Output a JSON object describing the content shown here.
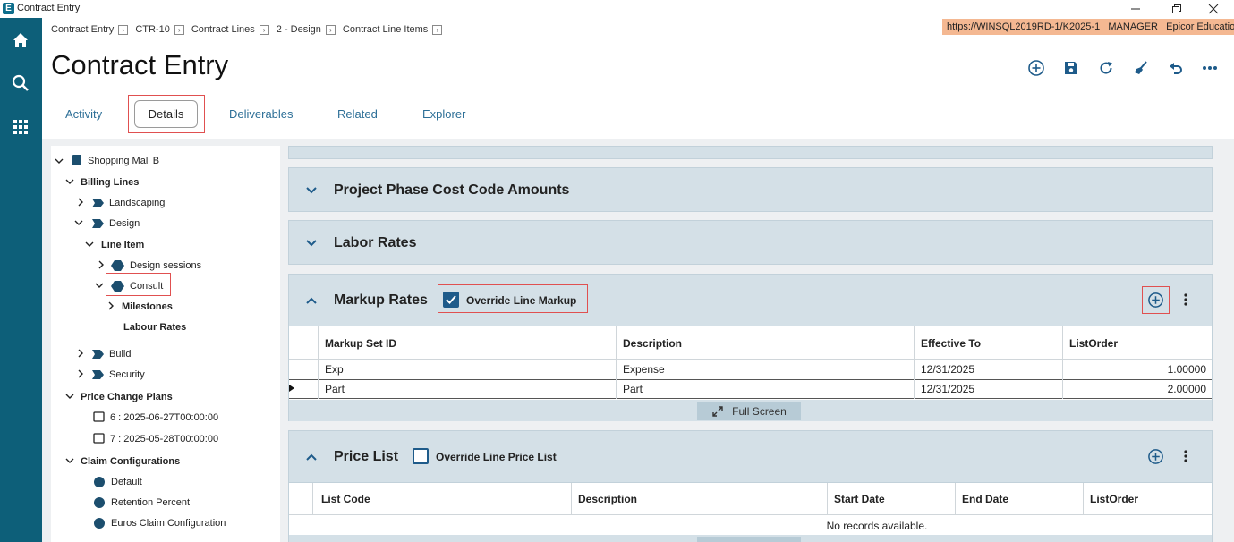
{
  "window": {
    "title": "Contract Entry",
    "logo": "E"
  },
  "breadcrumbs": [
    "Contract Entry",
    "CTR-10",
    "Contract Lines",
    "2 - Design",
    "Contract Line Items"
  ],
  "env": {
    "server": "https://WINSQL2019RD-1/K2025-1",
    "user": "MANAGER",
    "company": "Epicor Education"
  },
  "page_title": "Contract Entry",
  "toolbar_icons": [
    "add-icon",
    "save-icon",
    "refresh-icon",
    "clear-icon",
    "undo-icon",
    "more-icon"
  ],
  "tabs": {
    "activity": "Activity",
    "details": "Details",
    "deliverables": "Deliverables",
    "related": "Related",
    "explorer": "Explorer"
  },
  "tree": {
    "root": "Shopping Mall B",
    "billing_lines": "Billing Lines",
    "landscaping": "Landscaping",
    "design": "Design",
    "line_item": "Line Item",
    "design_sessions": "Design sessions",
    "consult": "Consult",
    "milestones": "Milestones",
    "labour_rates": "Labour Rates",
    "build": "Build",
    "security": "Security",
    "price_change_plans": "Price Change Plans",
    "plan6": "6 : 2025-06-27T00:00:00",
    "plan7": "7 : 2025-05-28T00:00:00",
    "claim_configurations": "Claim Configurations",
    "claim_default": "Default",
    "claim_retention": "Retention Percent",
    "claim_euros": "Euros Claim Configuration"
  },
  "panels": {
    "phase_cost": "Project Phase Cost Code Amounts",
    "labor_rates": "Labor Rates",
    "markup_rates": "Markup Rates",
    "override_markup": "Override Line Markup",
    "override_markup_checked": true,
    "price_list": "Price List",
    "override_price": "Override Line Price List",
    "override_price_checked": false
  },
  "markup_grid": {
    "headers": [
      "Markup Set ID",
      "Description",
      "Effective To",
      "ListOrder"
    ],
    "rows": [
      [
        "Exp",
        "Expense",
        "12/31/2025",
        "1.00000"
      ],
      [
        "Part",
        "Part",
        "12/31/2025",
        "2.00000"
      ]
    ],
    "full_screen": "Full Screen"
  },
  "price_grid": {
    "headers": [
      "List Code",
      "Description",
      "Start Date",
      "End Date",
      "ListOrder"
    ],
    "empty": "No records available."
  },
  "colors": {
    "rail": "#0d5f79",
    "accent": "#2d6f97",
    "panel": "#d4e0e7",
    "highlight": "#e05050",
    "env": "#f4b892"
  }
}
